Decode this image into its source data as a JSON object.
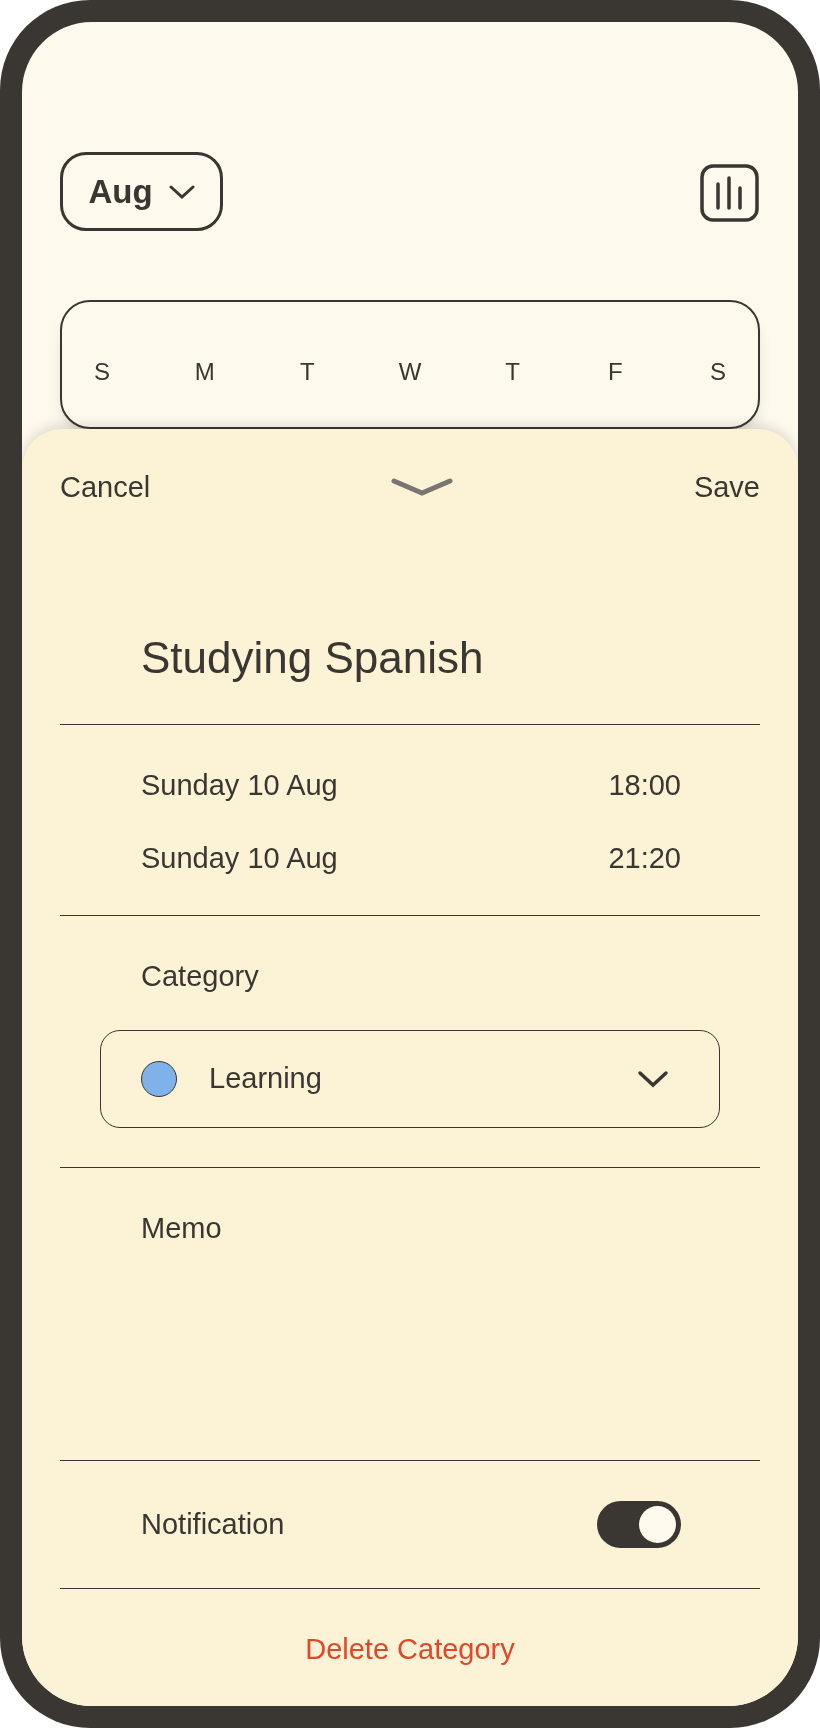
{
  "month_selector": {
    "label": "Aug"
  },
  "weekdays": [
    "S",
    "M",
    "T",
    "W",
    "T",
    "F",
    "S"
  ],
  "sheet": {
    "cancel": "Cancel",
    "save": "Save",
    "title": "Studying Spanish",
    "times": [
      {
        "date": "Sunday 10 Aug",
        "time": "18:00"
      },
      {
        "date": "Sunday 10 Aug",
        "time": "21:20"
      }
    ],
    "category_label": "Category",
    "category": {
      "name": "Learning",
      "color": "#7fb2ea"
    },
    "memo_label": "Memo",
    "notification": {
      "label": "Notification",
      "on": true
    },
    "delete": "Delete Category"
  }
}
